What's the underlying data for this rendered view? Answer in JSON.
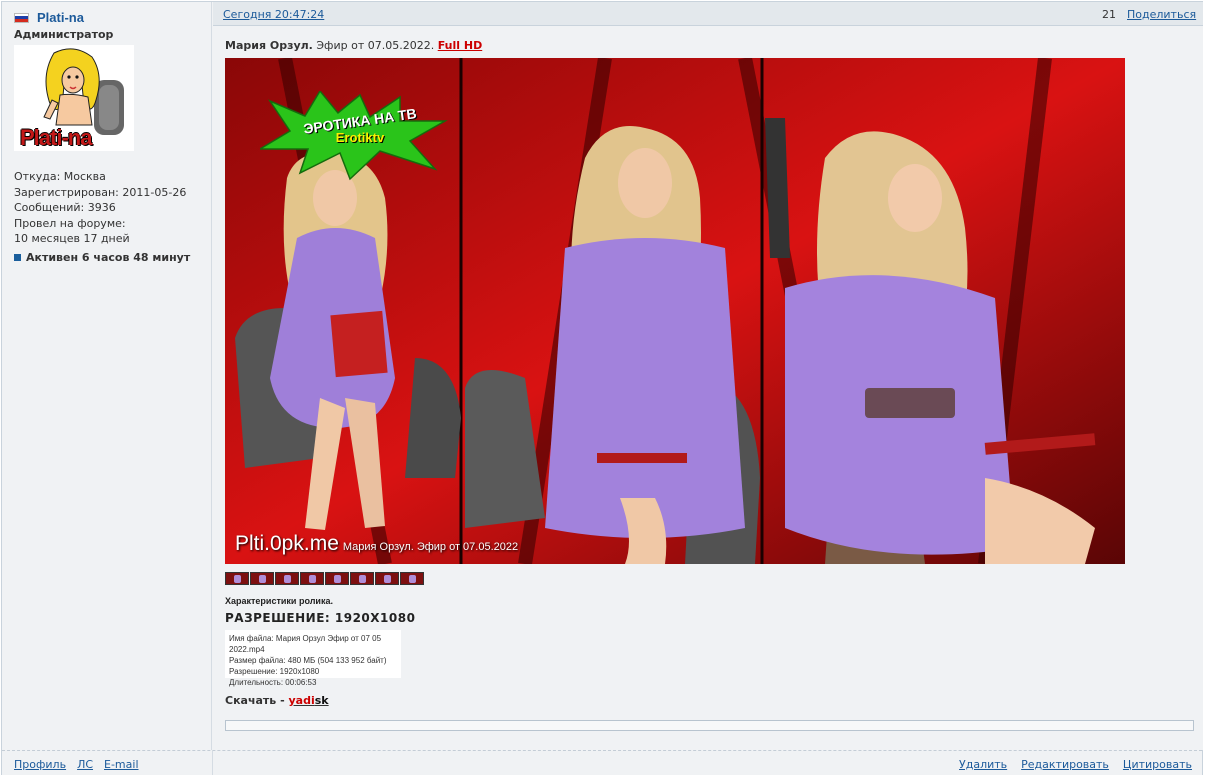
{
  "user": {
    "name": "Plati-na",
    "rank": "Администратор",
    "avatar_text": "Plati-na",
    "from": "Откуда: Москва",
    "registered": "Зарегистрирован: 2011-05-26",
    "posts": "Сообщений: 3936",
    "forum_time_label": "Провел на форуме:",
    "forum_time": "10 месяцев 17 дней",
    "active": "Активен 6 часов 48 минут"
  },
  "post": {
    "time": "Сегодня 20:47:24",
    "number": "21",
    "share": "Поделиться",
    "title_bold": "Мария Орзул.",
    "title_rest": " Эфир от 07.05.2022. ",
    "title_link": "Full HD",
    "image": {
      "logo_line1": "ЭРОТИКА НА ТВ",
      "logo_line2": "Erotiktv",
      "watermark_big": "Plti.0pk.me",
      "watermark_small": "Мария Орзул. Эфир от 07.05.2022"
    },
    "char_label": "Характеристики ролика.",
    "resolution": "РАЗРЕШЕНИЕ: 1920X1080",
    "meta": {
      "filename": "Имя файла: Мария Орзул Эфир от 07 05 2022.mp4",
      "size": "Размер файла: 480 МБ (504 133 952 байт)",
      "res": "Разрешение: 1920x1080",
      "duration": "Длительность: 00:06:53"
    },
    "download_label": "Скачать - ",
    "download_red": "yadi",
    "download_black": "sk"
  },
  "footer": {
    "profile": "Профиль",
    "pm": "ЛС",
    "email": "E-mail",
    "delete": "Удалить",
    "edit": "Редактировать",
    "quote": "Цитировать"
  },
  "colors": {
    "link": "#1c5a9a",
    "accent_red": "#cc0000",
    "panel_bg": "#f0f2f4"
  }
}
